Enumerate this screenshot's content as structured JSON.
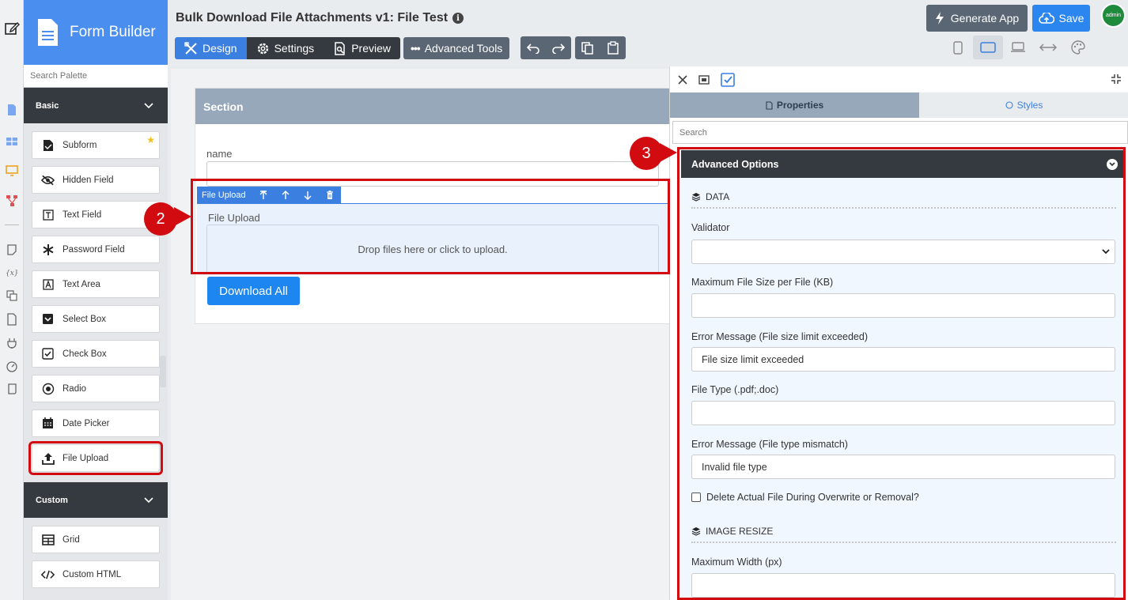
{
  "app": {
    "brand": "Form Builder",
    "form_title": "Bulk Download File Attachments v1: File Test"
  },
  "palette": {
    "search_placeholder": "Search Palette",
    "categories": [
      {
        "label": "Basic"
      },
      {
        "label": "Custom"
      }
    ],
    "basic_items": [
      {
        "label": "Subform",
        "icon": "subform-icon"
      },
      {
        "label": "Hidden Field",
        "icon": "eye-slash-icon"
      },
      {
        "label": "Text Field",
        "icon": "text-field-icon"
      },
      {
        "label": "Password Field",
        "icon": "asterisk-icon"
      },
      {
        "label": "Text Area",
        "icon": "text-area-icon"
      },
      {
        "label": "Select Box",
        "icon": "select-box-icon"
      },
      {
        "label": "Check Box",
        "icon": "check-box-icon"
      },
      {
        "label": "Radio",
        "icon": "radio-icon"
      },
      {
        "label": "Date Picker",
        "icon": "calendar-icon"
      },
      {
        "label": "File Upload",
        "icon": "upload-icon"
      }
    ],
    "custom_items": [
      {
        "label": "Grid",
        "icon": "grid-icon"
      },
      {
        "label": "Custom HTML",
        "icon": "code-icon"
      }
    ]
  },
  "toolbar": {
    "design": "Design",
    "settings": "Settings",
    "preview": "Preview",
    "advanced_tools": "Advanced Tools",
    "generate_app": "Generate App",
    "save": "Save",
    "avatar_text": "admin"
  },
  "canvas": {
    "section_title": "Section",
    "name_label": "name",
    "file_upload_toolbar_label": "File Upload",
    "file_upload_label": "File Upload",
    "drop_text": "Drop files here or click to upload.",
    "download_all": "Download All"
  },
  "callouts": {
    "two": "2",
    "three": "3"
  },
  "properties": {
    "tab_properties": "Properties",
    "tab_styles": "Styles",
    "search_placeholder": "Search",
    "advanced_options": "Advanced Options",
    "data_header": "DATA",
    "validator_label": "Validator",
    "validator_value": "",
    "max_file_size_label": "Maximum File Size per File (KB)",
    "max_file_size_value": "",
    "error_size_label": "Error Message (File size limit exceeded)",
    "error_size_value": "File size limit exceeded",
    "file_type_label": "File Type (.pdf;.doc)",
    "file_type_value": "",
    "error_type_label": "Error Message (File type mismatch)",
    "error_type_value": "Invalid file type",
    "delete_file_label": "Delete Actual File During Overwrite or Removal?",
    "delete_file_checked": false,
    "image_resize_header": "IMAGE RESIZE",
    "max_width_label": "Maximum Width (px)",
    "max_width_value": ""
  },
  "colors": {
    "brand_blue": "#4a8ff0",
    "highlight_red": "#d10b10",
    "dark": "#343a40",
    "section_header": "#97a8ba"
  }
}
